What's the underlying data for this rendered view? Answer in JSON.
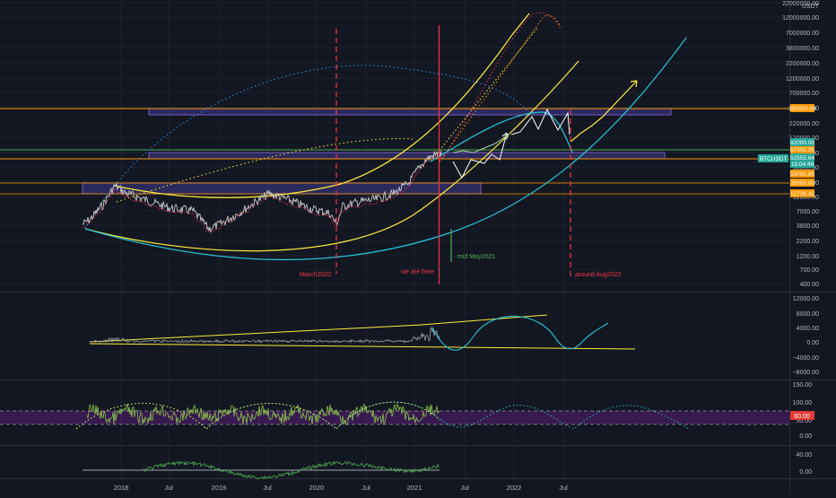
{
  "header": {
    "currency": "USDT"
  },
  "colors": {
    "background": "#131722",
    "grid": "#1e222d",
    "axis_text": "#b2b5be",
    "annotation_red": "#f23645",
    "orange": "#ff9800",
    "yellow": "#ffeb3b",
    "cyan": "#26c6da",
    "green": "#4caf50",
    "label_teal": "#26a69a",
    "label_red": "#e53935"
  },
  "time_axis": {
    "labels": [
      "2018",
      "Jul",
      "2019",
      "Jul",
      "2020",
      "Jul",
      "2021",
      "Jul",
      "2022",
      "Jul"
    ]
  },
  "price_pane": {
    "scale": "log",
    "ticks": [
      "22000000.00",
      "12000000.00",
      "7000000.00",
      "3800000.00",
      "2200000.00",
      "1200000.00",
      "700000.00",
      "380000.00",
      "220000.00",
      "120000.00",
      "70000.00",
      "38000.00",
      "22000.00",
      "12000.00",
      "7000.00",
      "3800.00",
      "2200.00",
      "1200.00",
      "700.00",
      "400.00"
    ],
    "price_labels": [
      {
        "name": "level-350000",
        "text": "350000.00",
        "color": "orange"
      },
      {
        "name": "level-67000",
        "text": "67000.00",
        "color": "orange"
      },
      {
        "name": "level-62000",
        "text": "62000.00",
        "color": "label_teal"
      },
      {
        "name": "symbol-price",
        "text": "52555.64",
        "color": "label_teal"
      },
      {
        "name": "countdown",
        "text": "15:04:49",
        "color": "label_teal"
      },
      {
        "name": "level-50000",
        "text": "50000.00",
        "color": "orange"
      },
      {
        "name": "level-20000",
        "text": "20000.00",
        "color": "orange"
      },
      {
        "name": "level-12736",
        "text": "12736.42",
        "color": "orange"
      }
    ],
    "symbol_tag": "BTCUSDT",
    "annotations": {
      "march2020": "March2020",
      "we_are_here": "we are here",
      "mid_may": "mid May2021",
      "around_aug": "around Aug2022"
    }
  },
  "oscillator_pane": {
    "ticks": [
      "12000.00",
      "8000.00",
      "4000.00",
      "0.00",
      "−4000.00",
      "−8000.00"
    ]
  },
  "rsi_pane": {
    "ticks": [
      "150.00",
      "100.00",
      "50.00",
      "0.00"
    ],
    "value_label": "60.00"
  },
  "bottom_pane": {
    "ticks": [
      "40.00",
      "0.00"
    ]
  }
}
